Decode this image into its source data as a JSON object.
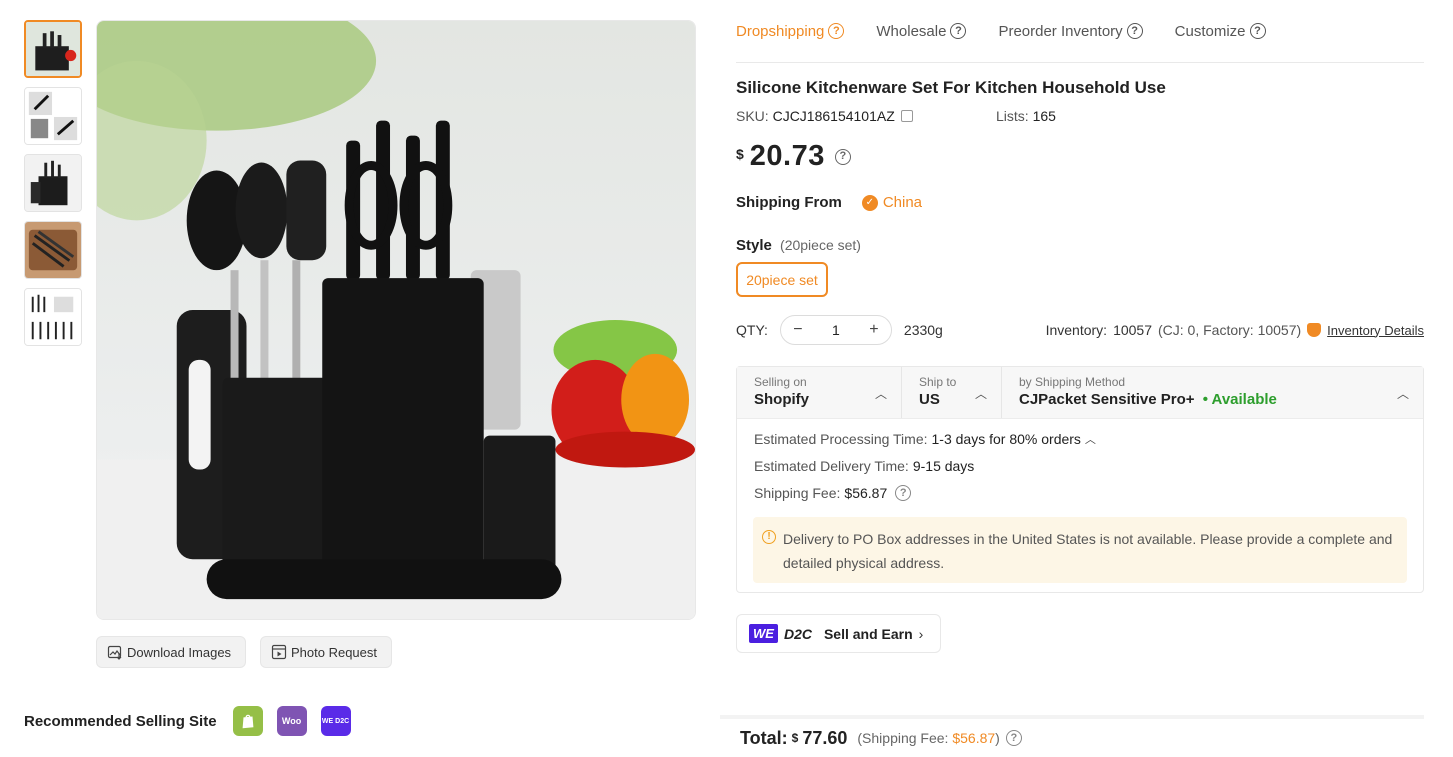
{
  "tabs": [
    {
      "label": "Dropshipping",
      "active": true
    },
    {
      "label": "Wholesale",
      "active": false
    },
    {
      "label": "Preorder Inventory",
      "active": false
    },
    {
      "label": "Customize",
      "active": false
    }
  ],
  "product": {
    "title": "Silicone Kitchenware Set For Kitchen Household Use",
    "sku_label": "SKU:",
    "sku": "CJCJ186154101AZ",
    "lists_label": "Lists:",
    "lists": "165",
    "currency": "$",
    "price": "20.73"
  },
  "shipping_from": {
    "label": "Shipping From",
    "country": "China"
  },
  "style": {
    "label": "Style",
    "selected_note": "(20piece set)",
    "option": "20piece set"
  },
  "qty": {
    "label": "QTY:",
    "decrement": "−",
    "value": "1",
    "increment": "+",
    "weight": "2330g",
    "inventory_label": "Inventory:",
    "inventory": "10057",
    "inventory_breakdown": "(CJ: 0, Factory: 10057)",
    "details_link": "Inventory Details"
  },
  "shipping": {
    "selling_on_label": "Selling on",
    "selling_on": "Shopify",
    "ship_to_label": "Ship to",
    "ship_to": "US",
    "method_label": "by Shipping Method",
    "method": "CJPacket Sensitive Pro+",
    "availability": "• Available",
    "processing_label": "Estimated Processing Time:",
    "processing": "1-3 days for 80% orders",
    "delivery_label": "Estimated Delivery Time:",
    "delivery": "9-15 days",
    "fee_label": "Shipping Fee:",
    "fee": "$56.87",
    "warning": "Delivery to PO Box addresses in the United States is not available. Please provide a complete and detailed physical address."
  },
  "d2c": {
    "we": "WE",
    "d2c": "D2C",
    "label": "Sell and Earn"
  },
  "images": {
    "download_label": "Download Images",
    "photo_request_label": "Photo Request"
  },
  "recommended": {
    "label": "Recommended Selling Site",
    "sites": [
      {
        "name": "shopify-icon",
        "text": "",
        "color": "#95bf47"
      },
      {
        "name": "woocommerce-icon",
        "text": "Woo",
        "color": "#7f54b3"
      },
      {
        "name": "we-d2c-icon",
        "text": "WE D2C",
        "color": "#5a2be8"
      }
    ]
  },
  "total": {
    "label": "Total:",
    "currency": "$",
    "amount": "77.60",
    "fee_prefix": "(Shipping Fee:",
    "fee": "$56.87",
    "fee_suffix": ")"
  },
  "colors": {
    "accent": "#f08a24",
    "available": "#2d9e2d",
    "warning_bg": "#fdf6e6"
  }
}
